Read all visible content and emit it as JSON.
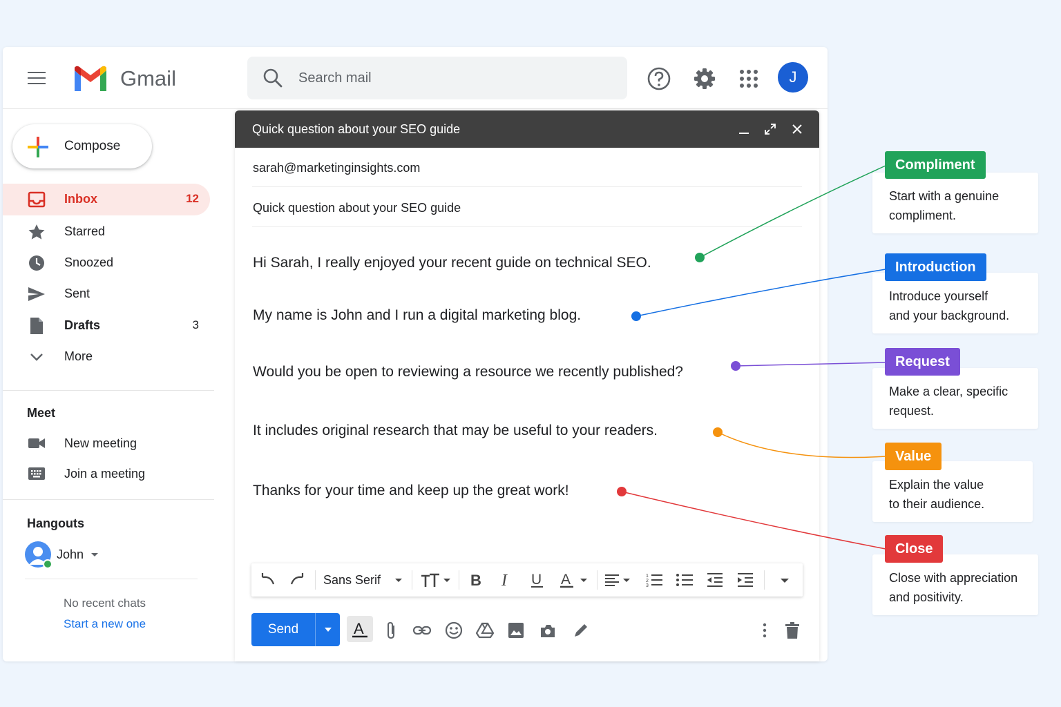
{
  "app": {
    "brand": "Gmail",
    "search_placeholder": "Search mail",
    "avatar_initial": "J",
    "colors": {
      "accent": "#1a73e8",
      "active_bg": "#fce8e6",
      "active_text": "#d93025"
    }
  },
  "sidebar": {
    "compose_label": "Compose",
    "items": [
      {
        "label": "Inbox",
        "count": "12",
        "icon": "inbox-icon"
      },
      {
        "label": "Starred",
        "count": "",
        "icon": "star-icon"
      },
      {
        "label": "Snoozed",
        "count": "",
        "icon": "clock-icon"
      },
      {
        "label": "Sent",
        "count": "",
        "icon": "send-icon"
      },
      {
        "label": "Drafts",
        "count": "3",
        "icon": "draft-icon"
      },
      {
        "label": "More",
        "count": "",
        "icon": "chevron-down-icon"
      }
    ],
    "meet": {
      "heading": "Meet",
      "new_meeting": "New meeting",
      "join_meeting": "Join a meeting"
    },
    "hangouts": {
      "heading": "Hangouts",
      "user": "John",
      "no_recent": "No recent chats",
      "start_new": "Start a new one"
    }
  },
  "compose": {
    "title": "Quick question about your SEO guide",
    "to": "sarah@marketinginsights.com",
    "subject": "Quick question about your SEO guide",
    "body": [
      "Hi Sarah, I really enjoyed your recent guide on technical SEO.",
      "My name is John and I run a digital marketing blog.",
      "Would you be open to reviewing a resource we recently published?",
      "It includes original research that may be useful to your readers.",
      "Thanks for your time and keep up the great work!"
    ],
    "font": "Sans Serif",
    "send_label": "Send"
  },
  "annotations": [
    {
      "tag": "Compliment",
      "text_1": "Start with a genuine",
      "text_2": "compliment.",
      "color": "#21a35a"
    },
    {
      "tag": "Introduction",
      "text_1": "Introduce yourself",
      "text_2": "and your background.",
      "color": "#1670e3"
    },
    {
      "tag": "Request",
      "text_1": "Make a clear, specific",
      "text_2": "request.",
      "color": "#7a4fd6"
    },
    {
      "tag": "Value",
      "text_1": "Explain the value",
      "text_2": "to their audience.",
      "color": "#f5920e"
    },
    {
      "tag": "Close",
      "text_1": "Close with appreciation",
      "text_2": "and positivity.",
      "color": "#e2393b"
    }
  ]
}
